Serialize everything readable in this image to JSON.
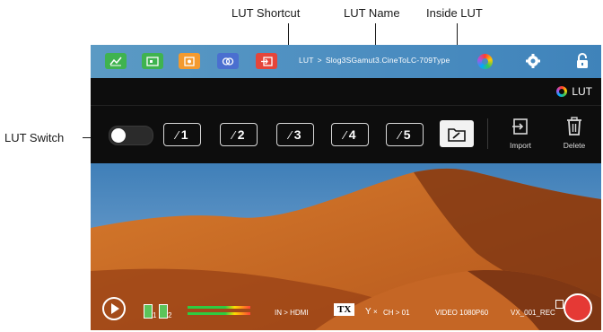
{
  "callouts": {
    "shortcut": "LUT Shortcut",
    "name": "LUT Name",
    "inside": "Inside LUT",
    "switch": "LUT Switch"
  },
  "topbar": {
    "breadcrumb_root": "LUT",
    "breadcrumb_sep": ">",
    "lut_name": "Slog3SGamut3.CineToLC-709Type",
    "button_colors": [
      "#3fb34f",
      "#3fb34f",
      "#f39a2e",
      "#4a6fd0",
      "#e5453a"
    ]
  },
  "title": {
    "label": "LUT"
  },
  "shortcuts": [
    {
      "number": "1"
    },
    {
      "number": "2"
    },
    {
      "number": "3"
    },
    {
      "number": "4"
    },
    {
      "number": "5"
    }
  ],
  "tools": {
    "import_label": "Import",
    "delete_label": "Delete"
  },
  "status": {
    "input": "IN > HDMI",
    "tx": "TX",
    "channel": "CH > 01",
    "video": "VIDEO 1080P60",
    "filename": "VX_001_REC",
    "battery1": "1",
    "battery2": "2"
  }
}
